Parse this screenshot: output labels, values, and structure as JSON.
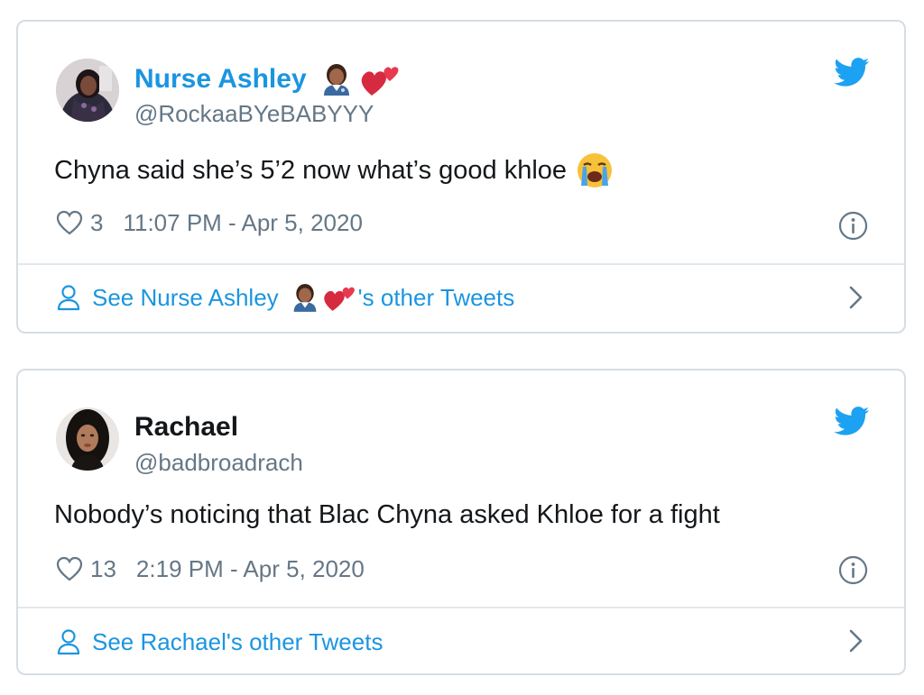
{
  "tweets": [
    {
      "author_name": "Nurse Ashley",
      "author_emojis": [
        "health-worker-emoji",
        "two-hearts-emoji"
      ],
      "handle": "@RockaaBYeBABYYY",
      "text": "Chyna said she’s 5’2 now what’s good khloe",
      "text_emoji": "loudly-crying-face-emoji",
      "likes": "3",
      "timestamp": "11:07 PM - Apr 5, 2020",
      "footer_prefix": "See Nurse Ashley",
      "footer_suffix": "'s other Tweets"
    },
    {
      "author_name": "Rachael",
      "handle": "@badbroadrach",
      "text": "Nobody’s noticing that Blac Chyna asked Khloe for a fight",
      "likes": "13",
      "timestamp": "2:19 PM - Apr 5, 2020",
      "footer_text": "See Rachael's other Tweets"
    }
  ],
  "colors": {
    "accent": "#1b95e0",
    "text": "#14171a",
    "secondary": "#657786",
    "border": "#d6dde3"
  }
}
